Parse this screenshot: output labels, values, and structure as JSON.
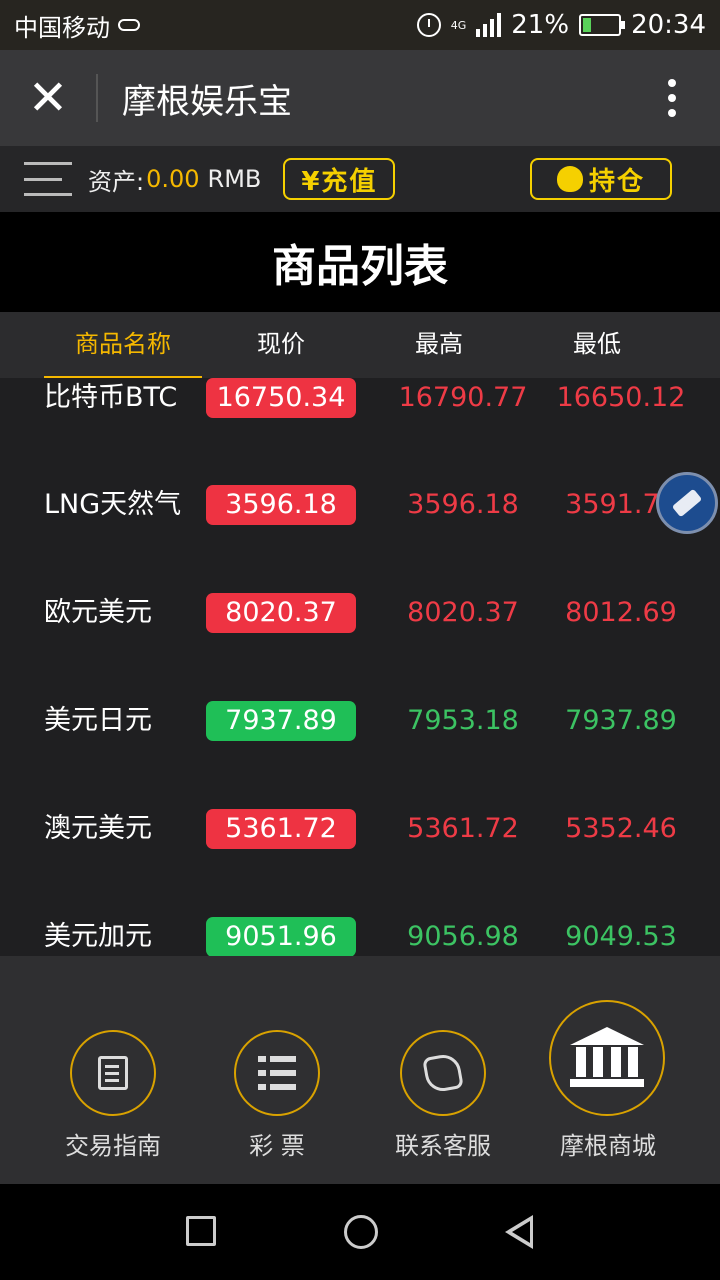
{
  "status_bar": {
    "carrier": "中国移动",
    "network": "4G",
    "battery": "21%",
    "time": "20:34",
    "icons": [
      "cloud-icon",
      "alarm-icon",
      "signal-icon",
      "battery-icon"
    ]
  },
  "app_bar": {
    "close_glyph": "✕",
    "title": "摩根娱乐宝"
  },
  "asset_bar": {
    "label": "资产:",
    "value": "0.00",
    "unit": "RMB",
    "recharge_label": "¥充值",
    "position_label": "持仓"
  },
  "page_title": "商品列表",
  "table": {
    "headers": [
      "商品名称",
      "现价",
      "最高",
      "最低"
    ],
    "rows": [
      {
        "name": "比特币BTC",
        "price": "16750.34",
        "high": "16790.77",
        "low": "16650.12",
        "trend": "up"
      },
      {
        "name": "LNG天然气",
        "price": "3596.18",
        "high": "3596.18",
        "low": "3591.77",
        "trend": "up"
      },
      {
        "name": "欧元美元",
        "price": "8020.37",
        "high": "8020.37",
        "low": "8012.69",
        "trend": "up"
      },
      {
        "name": "美元日元",
        "price": "7937.89",
        "high": "7953.18",
        "low": "7937.89",
        "trend": "down"
      },
      {
        "name": "澳元美元",
        "price": "5361.72",
        "high": "5361.72",
        "low": "5352.46",
        "trend": "up"
      },
      {
        "name": "美元加元",
        "price": "9051.96",
        "high": "9056.98",
        "low": "9049.53",
        "trend": "down"
      }
    ]
  },
  "bottom_nav": {
    "items": [
      {
        "label": "交易指南",
        "icon": "document-icon"
      },
      {
        "label": "彩 票",
        "icon": "list-icon"
      },
      {
        "label": "联系客服",
        "icon": "phone-icon"
      },
      {
        "label": "摩根商城",
        "icon": "bank-icon"
      }
    ]
  },
  "colors": {
    "accent": "#f5b800",
    "up": "#ee3342",
    "down": "#1fbf57"
  }
}
